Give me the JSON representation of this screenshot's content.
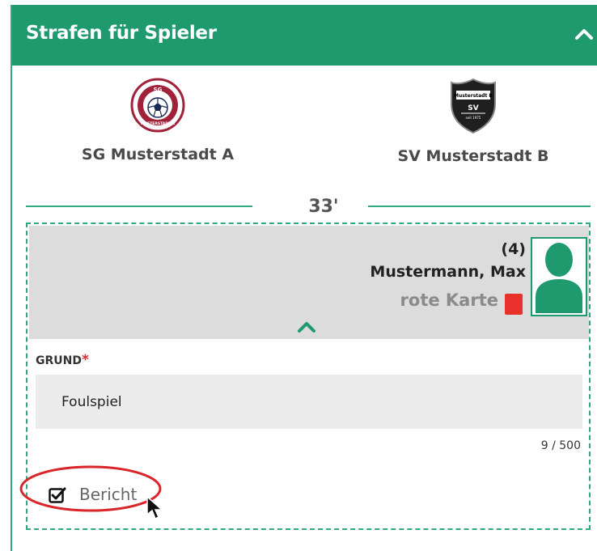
{
  "header": {
    "title": "Strafen für Spieler"
  },
  "teams": {
    "home": {
      "name": "SG Musterstadt A",
      "logo_text_top": "SG",
      "logo_text_ring": "MUSTERSTADT A"
    },
    "away": {
      "name": "SV Musterstadt B",
      "logo_text_top": "Musterstadt B",
      "logo_text_mid": "SV",
      "logo_text_bottom": "seit 1975"
    }
  },
  "event": {
    "minute": "33'",
    "player": {
      "number": "(4)",
      "name": "Mustermann, Max",
      "card_type": "rote Karte"
    }
  },
  "form": {
    "reason_label": "GRUND",
    "required_marker": "*",
    "reason_value": "Foulspiel",
    "char_count": "9 / 500",
    "report_label": "Bericht",
    "report_checked": true
  },
  "icons": {
    "collapse": "chevron-up-icon",
    "expand": "chevron-up-icon",
    "avatar": "person-silhouette-icon",
    "card": "red-card-icon",
    "checkbox": "checkbox-checked-icon",
    "cursor": "mouse-pointer-icon"
  },
  "colors": {
    "brand": "#1f9a6e",
    "red_card": "#e8312a",
    "highlight": "#d9262b"
  }
}
